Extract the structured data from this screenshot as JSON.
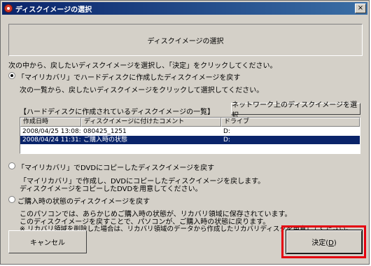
{
  "window": {
    "title": "ディスクイメージの選択",
    "close_glyph": "×"
  },
  "header": {
    "title": "ディスクイメージの選択"
  },
  "instruction": "次の中から、戻したいディスクイメージを選択し、「決定」をクリックしてください。",
  "option1": {
    "label": "「マイリカバリ」でハードディスクに作成したディスクイメージを戻す",
    "checked": true,
    "sub": "次の一覧から、戻したいディスクイメージをクリックして選択してください。",
    "list_caption": "【ハードディスクに作成されているディスクイメージの一覧】",
    "network_button": "ネットワーク上のディスクイメージを選択",
    "columns": [
      "作成日時",
      "ディスクイメージに付けたコメント",
      "ドライブ"
    ],
    "rows": [
      {
        "date": "2008/04/25 13:08:52",
        "comment": "080425_1251",
        "drive": "D:",
        "selected": false
      },
      {
        "date": "2008/04/24 11:31:50",
        "comment": "ご購入時の状態",
        "drive": "D:",
        "selected": true
      }
    ]
  },
  "option2": {
    "label": "「マイリカバリ」でDVDにコピーしたディスクイメージを戻す",
    "checked": false,
    "desc1": "「マイリカバリ」で作成し、DVDにコピーしたディスクイメージを戻します。",
    "desc2": "ディスクイメージをコピーしたDVDを用意してください。"
  },
  "option3": {
    "label": "ご購入時の状態のディスクイメージを戻す",
    "checked": false,
    "desc1": "このパソコンでは、あらかじめご購入時の状態が、リカバリ領域に保存されています。",
    "desc2": "このディスクイメージを戻すことで、パソコンが、ご購入時の状態に戻ります。",
    "desc3": "※ リカバリ領域を削除した場合は、リカバリ領域のデータから作成したリカバリディスクを用意してください。"
  },
  "buttons": {
    "cancel": "キャンセル",
    "ok_text": "決定(",
    "ok_key": "D",
    "ok_end": ")"
  },
  "colors": {
    "titlebar": "#0a246a",
    "selection": "#0a246a",
    "highlight": "#e5000f"
  }
}
